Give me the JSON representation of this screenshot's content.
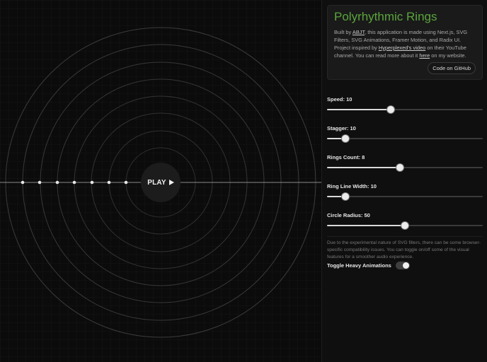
{
  "app": {
    "title": "Polyrhythmic Rings",
    "description_parts": [
      "Built by ",
      "ABJT",
      ", this application is made using Next.js, SVG Filters, SVG Animations, Framer Motion, and Radix UI. Project inspired by ",
      "Hyperplexed's video",
      " on their YouTube channel. You can read more about it ",
      "here",
      " on my website."
    ],
    "github_button": "Code on GitHub"
  },
  "play": {
    "label": "PLAY",
    "icon": "play-icon"
  },
  "controls": [
    {
      "label": "Speed: 10",
      "value": 0.41
    },
    {
      "label": "Stagger: 10",
      "value": 0.12
    },
    {
      "label": "Rings Count: 8",
      "value": 0.47
    },
    {
      "label": "Ring Line Width: 10",
      "value": 0.12
    },
    {
      "label": "Circle Radius: 50",
      "value": 0.5
    }
  ],
  "note": "Due to the experimental nature of SVG filters, there can be some browser-specific compatibility issues. You can toggle on/off some of the visual features for a smoother audio experience.",
  "toggle": {
    "label": "Toggle Heavy Animations",
    "on": true
  },
  "colors": {
    "accent": "#5aa53c",
    "ring": "#3a3a3a",
    "dot": "#e6e6e6"
  }
}
